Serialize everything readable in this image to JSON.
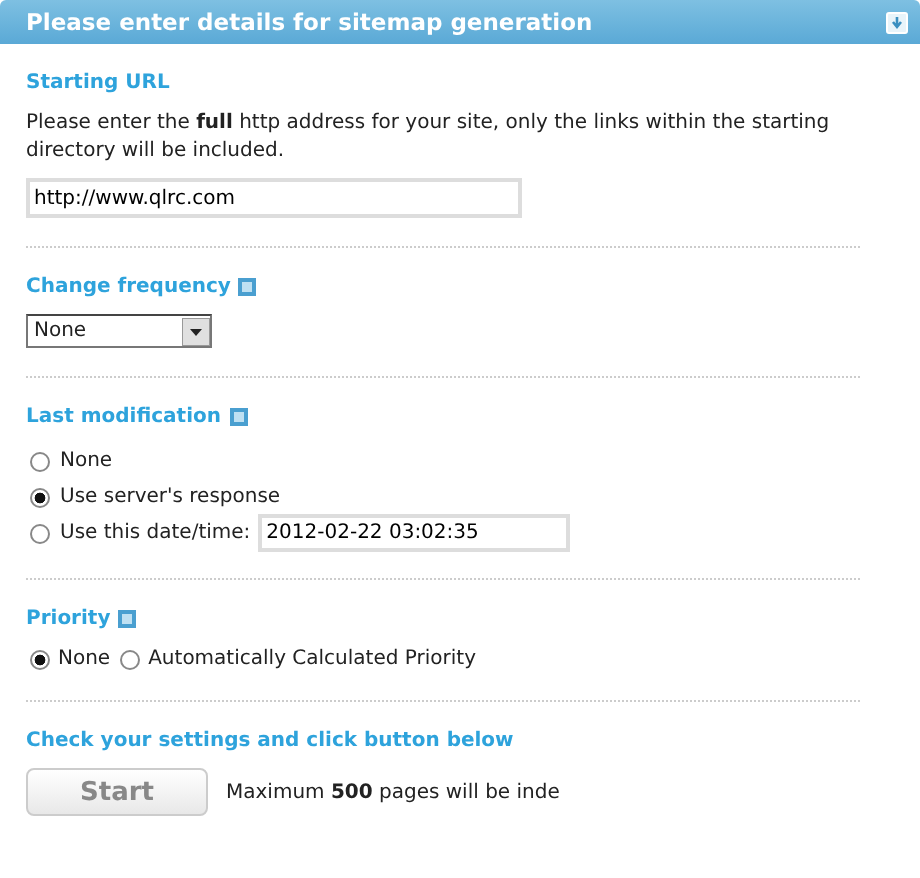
{
  "panel": {
    "title": "Please enter details for sitemap generation"
  },
  "starting_url": {
    "heading": "Starting URL",
    "description": "Please enter the **full** http address for your site, only the links within the starting directory will be included.",
    "value": "http://www.qlrc.com"
  },
  "change_frequency": {
    "heading": "Change frequency",
    "value": "None"
  },
  "last_modification": {
    "heading": "Last modification",
    "options": [
      {
        "label": "None",
        "selected": false,
        "kind": "plain"
      },
      {
        "label": "Use server's response",
        "selected": true,
        "kind": "plain"
      },
      {
        "label": "Use this date/time:",
        "selected": false,
        "kind": "date",
        "value": "2012-02-22 03:02:35"
      }
    ]
  },
  "priority": {
    "heading": "Priority",
    "options": [
      {
        "label": "None",
        "selected": true
      },
      {
        "label": "Automatically Calculated Priority",
        "selected": false
      }
    ]
  },
  "submit": {
    "heading": "Check your settings and click button below",
    "button": "Start",
    "note": "Maximum **500** pages will be inde"
  }
}
